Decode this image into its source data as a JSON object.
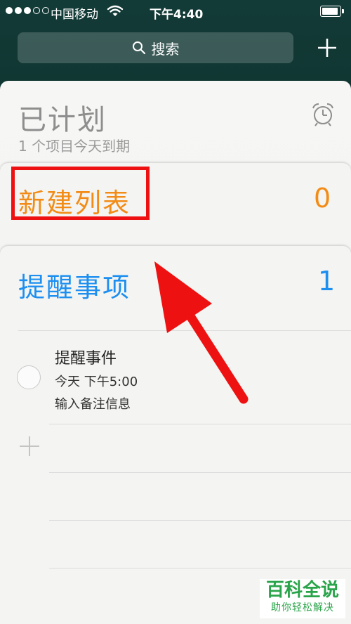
{
  "status_bar": {
    "carrier": "中国移动",
    "time": "下午4:40",
    "signal_dots_filled": 3,
    "signal_dots_total": 5
  },
  "search": {
    "label": "搜索",
    "icon": "search-icon"
  },
  "header": {
    "add_icon": "plus-icon"
  },
  "scheduled": {
    "title": "已计划",
    "subtitle": "1 个项目今天到期",
    "icon": "alarm-clock-icon"
  },
  "lists": [
    {
      "title": "新建列表",
      "count": "0",
      "color": "#f28c16"
    },
    {
      "title": "提醒事项",
      "count": "1",
      "color": "#1c8ff0"
    }
  ],
  "reminder_item": {
    "title": "提醒事件",
    "time": "今天 下午5:00",
    "note": "输入备注信息"
  },
  "annotation": {
    "box_color": "#ee1111",
    "arrow_color": "#ee1111"
  },
  "watermark": {
    "title": "百科全说",
    "subtitle": "助你轻松解决"
  }
}
